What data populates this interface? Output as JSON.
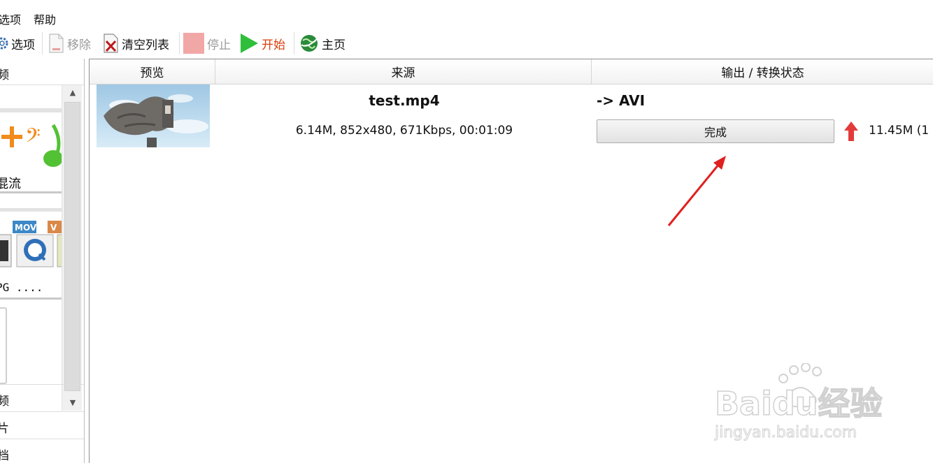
{
  "menu": {
    "options": "选项",
    "help": "帮助"
  },
  "toolbar": {
    "options": "选项",
    "remove": "移除",
    "clear_list": "清空列表",
    "stop": "停止",
    "start": "开始",
    "home": "主页"
  },
  "left_panel": {
    "header": "频",
    "category_1": "混流",
    "category_2": "PG ....",
    "format_badges": [
      "MOV",
      "V"
    ],
    "bottom_items": [
      "频",
      "片",
      "档"
    ]
  },
  "list": {
    "columns": [
      "预览",
      "来源",
      "输出 / 转换状态"
    ],
    "rows": [
      {
        "file_name": "test.mp4",
        "source_info": "6.14M, 852x480, 671Kbps, 00:01:09",
        "output_format": "-> AVI",
        "status": "完成",
        "output_size": "11.45M  (1"
      }
    ]
  },
  "watermark": {
    "brand": "Baidu经验",
    "url": "jingyan.baidu.com"
  },
  "colors": {
    "start_accent": "#d8400c",
    "play_green": "#2fbf3a",
    "annotation_red": "#e02020",
    "up_arrow_red": "#e23b3b"
  }
}
